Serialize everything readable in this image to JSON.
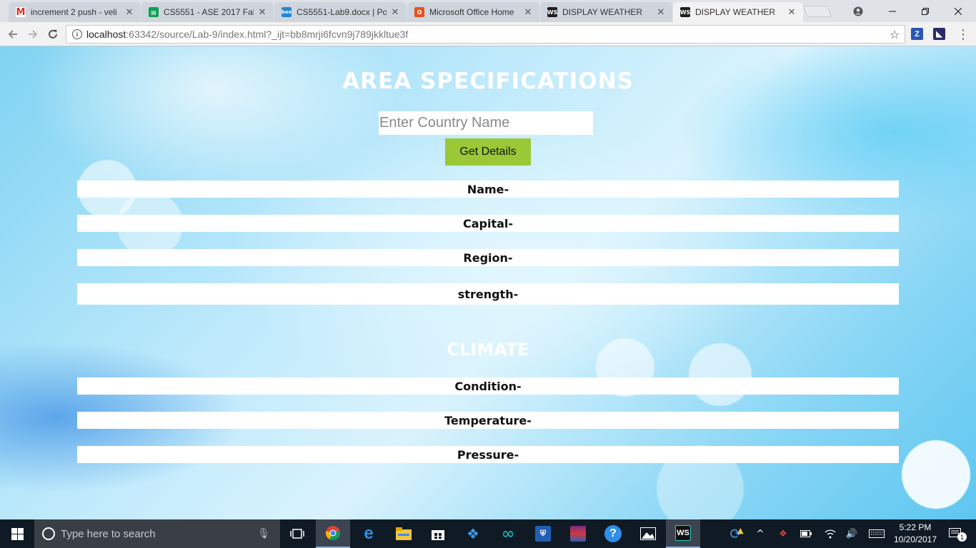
{
  "browser": {
    "tabs": [
      {
        "title": "increment 2 push - veli",
        "favicon": "gmail-icon",
        "color": "#d93025",
        "letter": "M"
      },
      {
        "title": "CS5551 - ASE 2017 Fall",
        "favicon": "sheets-icon",
        "color": "#0f9d58",
        "letter": "▤"
      },
      {
        "title": "CS5551-Lab9.docx | Po",
        "favicon": "box-icon",
        "color": "#2486d1",
        "letter": "box"
      },
      {
        "title": "Microsoft Office Home",
        "favicon": "office-icon",
        "color": "#e8511f",
        "letter": "O"
      },
      {
        "title": "DISPLAY WEATHER",
        "favicon": "webstorm-icon",
        "color": "#1d1d1d",
        "letter": "WS"
      },
      {
        "title": "DISPLAY WEATHER",
        "favicon": "webstorm-icon",
        "color": "#1d1d1d",
        "letter": "WS"
      }
    ],
    "url_host": "localhost",
    "url_rest": ":63342/source/Lab-9/index.html?_ijt=bb8mrji6fcvn9j789jkkltue3f"
  },
  "page": {
    "area_title": "AREA SPECIFICATIONS",
    "country_placeholder": "Enter Country Name",
    "get_details_label": "Get Details",
    "area_rows": [
      "Name-",
      "Capital-",
      "Region-",
      "strength-"
    ],
    "climate_title": "CLIMATE",
    "climate_rows": [
      "Condition-",
      "Temperature-",
      "Pressure-"
    ]
  },
  "taskbar": {
    "search_placeholder": "Type here to search",
    "time": "5:22 PM",
    "date": "10/20/2017",
    "notification_count": "1"
  }
}
